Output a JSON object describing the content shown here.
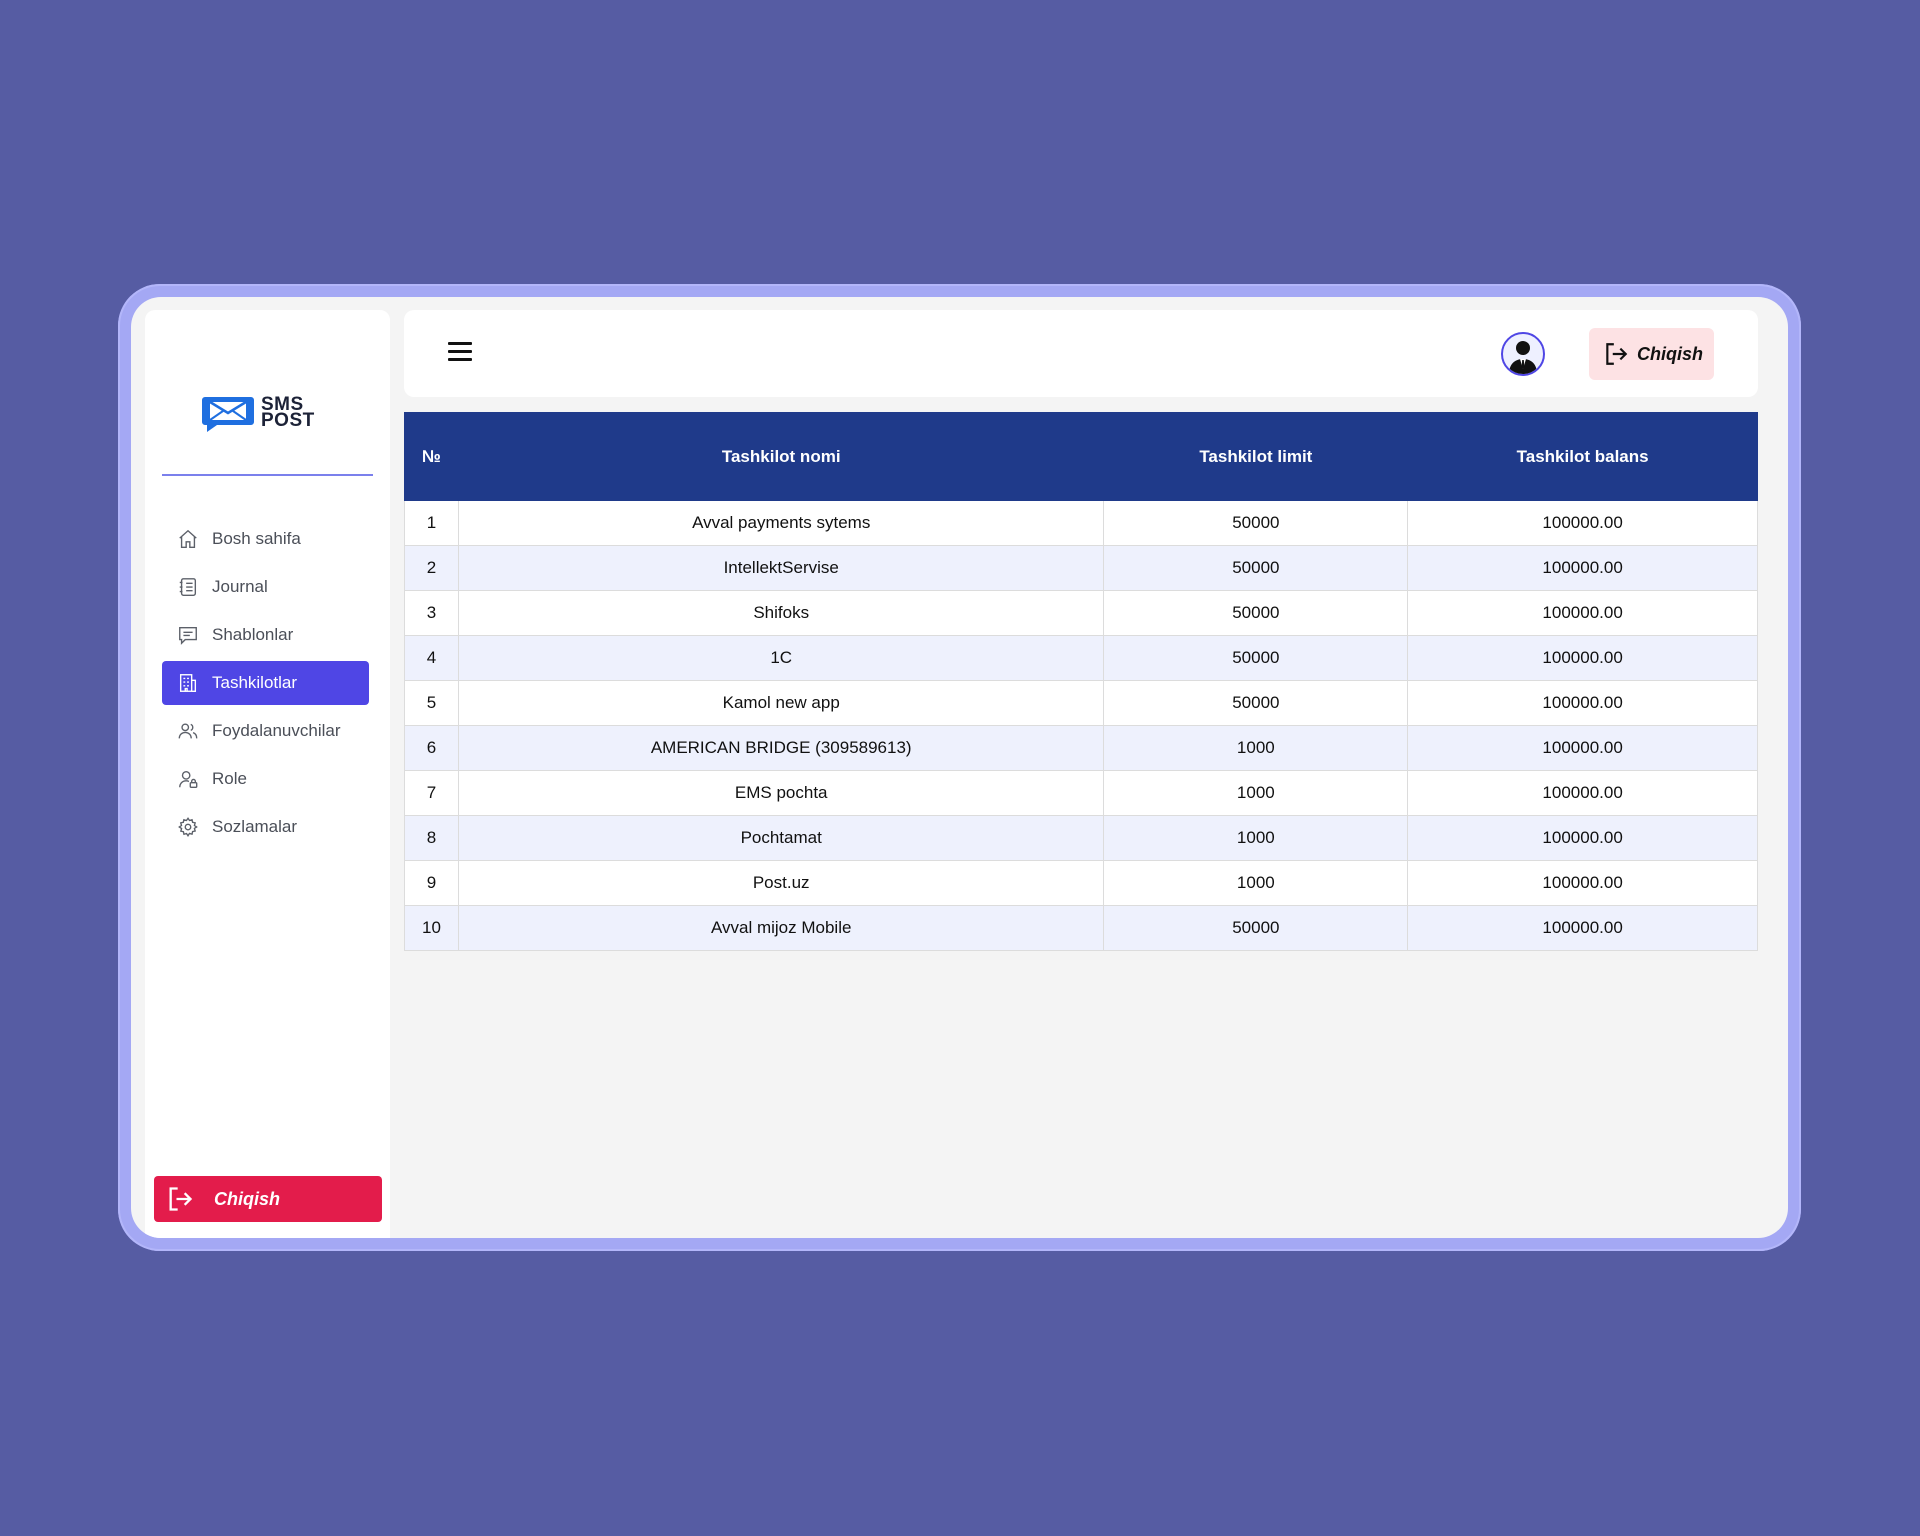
{
  "logo": {
    "line1": "SMS",
    "line2": "POST"
  },
  "sidebar": {
    "items": [
      {
        "label": "Bosh sahifa",
        "icon": "home-icon"
      },
      {
        "label": "Journal",
        "icon": "journal-icon"
      },
      {
        "label": "Shablonlar",
        "icon": "message-icon"
      },
      {
        "label": "Tashkilotlar",
        "icon": "building-icon",
        "active": true
      },
      {
        "label": "Foydalanuvchilar",
        "icon": "users-icon"
      },
      {
        "label": "Role",
        "icon": "user-lock-icon"
      },
      {
        "label": "Sozlamalar",
        "icon": "gear-icon"
      }
    ],
    "logout_label": "Chiqish"
  },
  "header": {
    "logout_label": "Chiqish"
  },
  "table": {
    "columns": [
      "№",
      "Tashkilot nomi",
      "Tashkilot limit",
      "Tashkilot balans"
    ],
    "rows": [
      [
        "1",
        "Avval payments sytems",
        "50000",
        "100000.00"
      ],
      [
        "2",
        "IntellektServise",
        "50000",
        "100000.00"
      ],
      [
        "3",
        "Shifoks",
        "50000",
        "100000.00"
      ],
      [
        "4",
        "1C",
        "50000",
        "100000.00"
      ],
      [
        "5",
        "Kamol new app",
        "50000",
        "100000.00"
      ],
      [
        "6",
        "AMERICAN BRIDGE (309589613)",
        "1000",
        "100000.00"
      ],
      [
        "7",
        "EMS pochta",
        "1000",
        "100000.00"
      ],
      [
        "8",
        "Pochtamat",
        "1000",
        "100000.00"
      ],
      [
        "9",
        "Post.uz",
        "1000",
        "100000.00"
      ],
      [
        "10",
        "Avval mijoz Mobile",
        "50000",
        "100000.00"
      ]
    ]
  },
  "colors": {
    "background": "#565ca3",
    "accent": "#4f46e5",
    "table_header": "#1f3a8a",
    "danger": "#e31c4b",
    "logout_soft": "#fde2e4"
  }
}
